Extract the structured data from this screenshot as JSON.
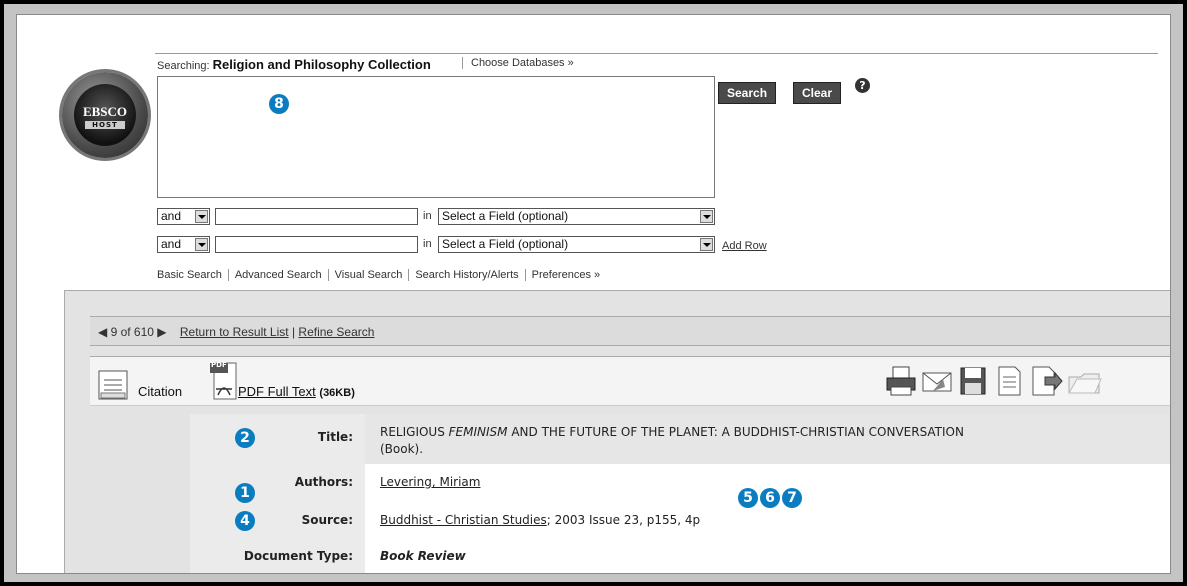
{
  "logo": {
    "line1": "EBSCO",
    "line2": "HOST"
  },
  "search": {
    "searching_label": "Searching:",
    "database": "Religion and Philosophy Collection",
    "choose_databases": "Choose Databases »",
    "search_button": "Search",
    "clear_button": "Clear",
    "help_icon": "?",
    "rows": [
      {
        "bool": "and",
        "in_label": "in",
        "field": "Select a Field (optional)"
      },
      {
        "bool": "and",
        "in_label": "in",
        "field": "Select a Field (optional)"
      }
    ],
    "add_row": "Add Row"
  },
  "nav": [
    "Basic Search",
    "Advanced Search",
    "Visual Search",
    "Search History/Alerts",
    "Preferences »"
  ],
  "result_nav": {
    "position": "9 of 610",
    "return": "Return to Result List",
    "separator": "|",
    "refine": "Refine Search"
  },
  "toolbar": {
    "citation": "Citation",
    "pdf_badge": "PDF",
    "pdf_full_text": "PDF Full Text",
    "pdf_size": "(36KB)"
  },
  "record": {
    "title_label": "Title:",
    "title_pre": "RELIGIOUS ",
    "title_em": "FEMINISM",
    "title_post": " AND THE FUTURE OF THE PLANET: A BUDDHIST-CHRISTIAN CONVERSATION",
    "title_line2": "(Book).",
    "authors_label": "Authors:",
    "authors": "Levering, Miriam",
    "source_label": "Source:",
    "source_link": "Buddhist - Christian Studies",
    "source_rest": "; 2003 Issue 23, p155, 4p",
    "doctype_label": "Document Type:",
    "doctype": "Book Review"
  },
  "badges": [
    "8",
    "2",
    "1",
    "4",
    "5",
    "6",
    "7"
  ],
  "colors": {
    "badge": "#0a7dc0",
    "frame": "#c4c4c4"
  }
}
